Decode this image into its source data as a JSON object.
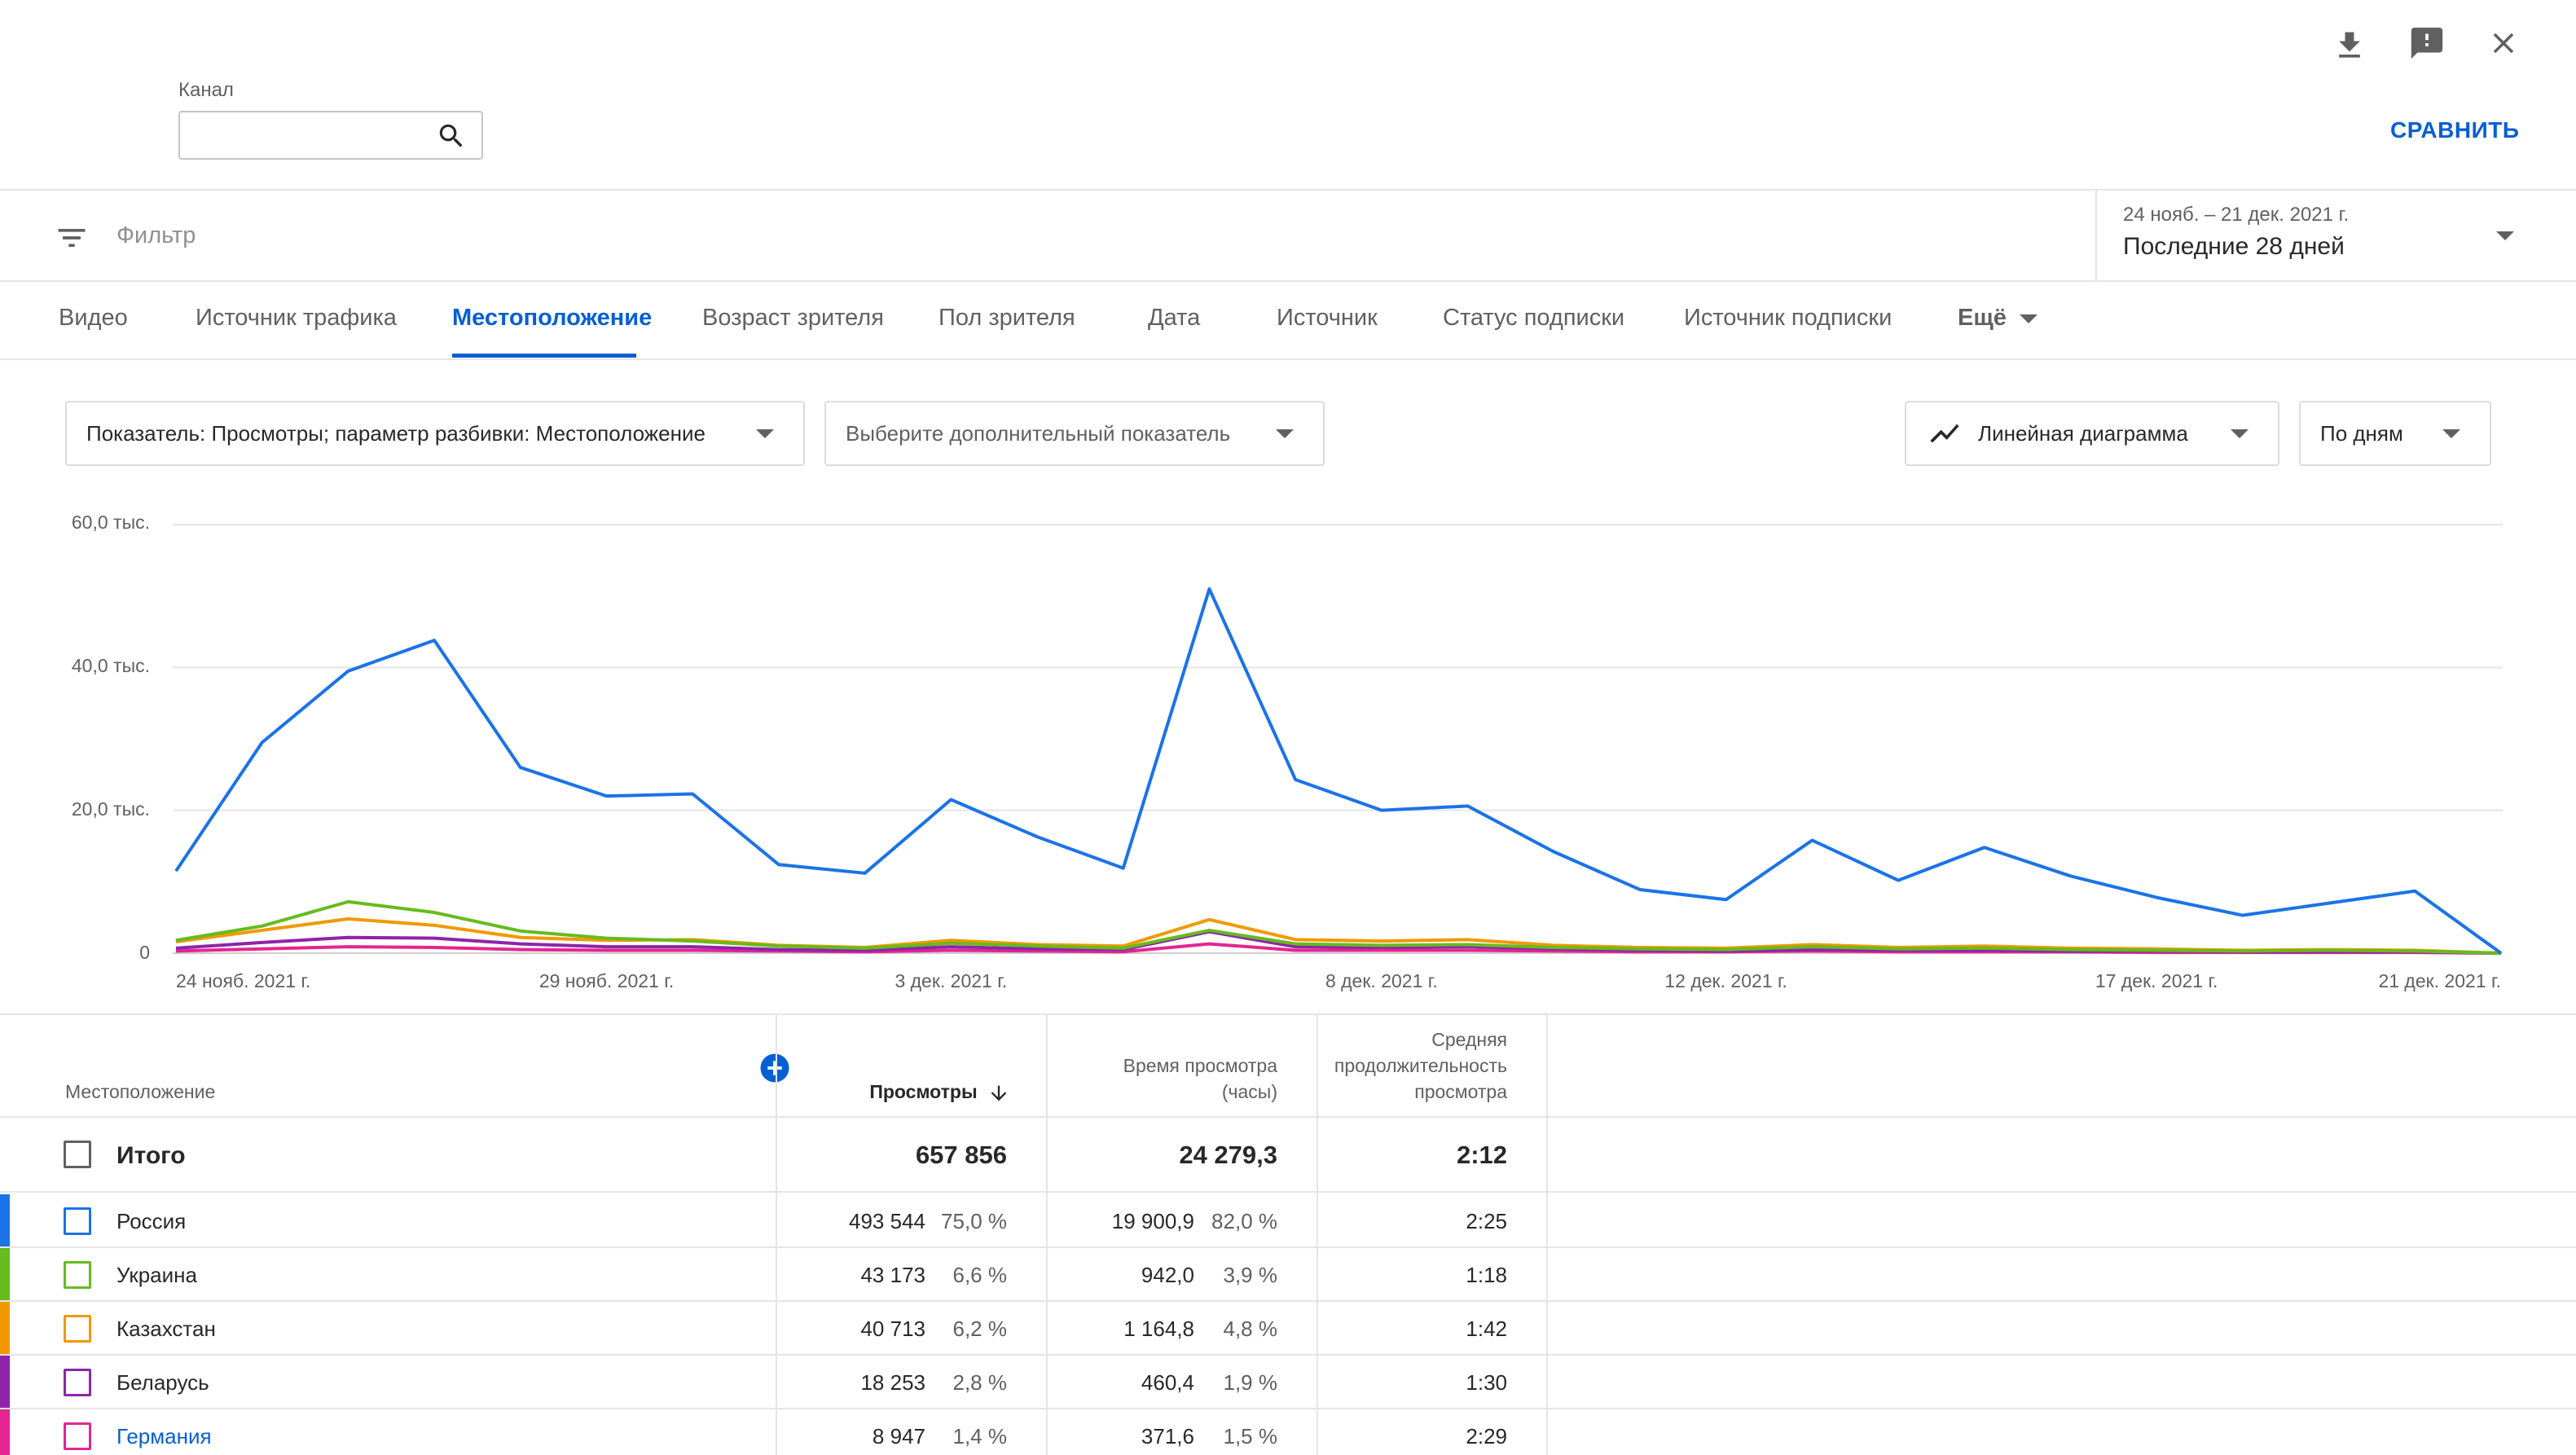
{
  "header": {
    "channel_label": "Канал",
    "search_placeholder": "",
    "compare_label": "СРАВНИТЬ"
  },
  "filter": {
    "label": "Фильтр",
    "date_range": "24 нояб. – 21 дек. 2021 г.",
    "period": "Последние 28 дней"
  },
  "tabs": [
    "Видео",
    "Источник трафика",
    "Местоположение",
    "Возраст зрителя",
    "Пол зрителя",
    "Дата",
    "Источник",
    "Статус подписки",
    "Источник подписки",
    "Ещё"
  ],
  "active_tab": "Местоположение",
  "controls": {
    "metric": "Показатель: Просмотры; параметр разбивки: Местоположение",
    "secondary_metric": "Выберите дополнительный показатель",
    "chart_type": "Линейная диаграмма",
    "granularity": "По дням"
  },
  "chart_data": {
    "type": "line",
    "y_ticks": [
      "60,0 тыс.",
      "40,0 тыс.",
      "20,0 тыс.",
      "0"
    ],
    "ylim": [
      0,
      60000
    ],
    "x_tick_labels": [
      {
        "label": "24 нояб. 2021 г.",
        "day": 0
      },
      {
        "label": "29 нояб. 2021 г.",
        "day": 5
      },
      {
        "label": "3 дек. 2021 г.",
        "day": 9
      },
      {
        "label": "8 дек. 2021 г.",
        "day": 14
      },
      {
        "label": "12 дек. 2021 г.",
        "day": 18
      },
      {
        "label": "17 дек. 2021 г.",
        "day": 23
      },
      {
        "label": "21 дек. 2021 г.",
        "day": 27
      }
    ],
    "days": 28,
    "grid": true,
    "series": [
      {
        "name": "Россия",
        "color": "#1a73e8",
        "values": [
          11500,
          29500,
          39500,
          43800,
          26000,
          22000,
          22300,
          12400,
          11200,
          21500,
          16300,
          11900,
          51000,
          24300,
          20000,
          20600,
          14200,
          8900,
          7500,
          15800,
          10200,
          14800,
          10800,
          7800,
          5300,
          7000,
          8700,
          0
        ]
      },
      {
        "name": "Украина",
        "color": "#66bb1e",
        "values": [
          1800,
          3800,
          7200,
          5700,
          3100,
          2100,
          1700,
          1000,
          700,
          1400,
          1000,
          700,
          3200,
          1300,
          1100,
          1200,
          800,
          600,
          500,
          900,
          600,
          700,
          500,
          400,
          300,
          400,
          300,
          0
        ]
      },
      {
        "name": "Казахстан",
        "color": "#f29900",
        "values": [
          1600,
          3200,
          4800,
          3900,
          2200,
          1800,
          1900,
          1100,
          800,
          1800,
          1200,
          1000,
          4700,
          1900,
          1700,
          1900,
          1100,
          800,
          700,
          1200,
          800,
          1000,
          700,
          600,
          400,
          500,
          400,
          0
        ]
      },
      {
        "name": "Беларусь",
        "color": "#8e24aa",
        "values": [
          700,
          1500,
          2200,
          2100,
          1300,
          900,
          900,
          500,
          400,
          900,
          600,
          500,
          3000,
          900,
          800,
          900,
          600,
          400,
          300,
          500,
          400,
          400,
          300,
          300,
          200,
          200,
          200,
          0
        ]
      },
      {
        "name": "Германия",
        "color": "#e52592",
        "values": [
          300,
          600,
          900,
          800,
          500,
          400,
          400,
          300,
          200,
          400,
          300,
          200,
          1300,
          400,
          400,
          400,
          300,
          200,
          200,
          300,
          200,
          200,
          200,
          100,
          100,
          100,
          100,
          0
        ]
      }
    ]
  },
  "table": {
    "col_location": "Местоположение",
    "col_views": "Просмотры",
    "col_watch_time_line1": "Время просмотра",
    "col_watch_time_line2": "(часы)",
    "col_avg_line1": "Средняя",
    "col_avg_line2": "продолжительность",
    "col_avg_line3": "просмотра",
    "total": {
      "label": "Итого",
      "views": "657 856",
      "watch_time": "24 279,3",
      "avg": "2:12"
    },
    "rows": [
      {
        "name": "Россия",
        "color": "#1a73e8",
        "views": "493 544",
        "views_pct": "75,0 %",
        "watch_time": "19 900,9",
        "watch_pct": "82,0 %",
        "avg": "2:25"
      },
      {
        "name": "Украина",
        "color": "#66bb1e",
        "views": "43 173",
        "views_pct": "6,6 %",
        "watch_time": "942,0",
        "watch_pct": "3,9 %",
        "avg": "1:18"
      },
      {
        "name": "Казахстан",
        "color": "#f29900",
        "views": "40 713",
        "views_pct": "6,2 %",
        "watch_time": "1 164,8",
        "watch_pct": "4,8 %",
        "avg": "1:42"
      },
      {
        "name": "Беларусь",
        "color": "#8e24aa",
        "views": "18 253",
        "views_pct": "2,8 %",
        "watch_time": "460,4",
        "watch_pct": "1,9 %",
        "avg": "1:30"
      },
      {
        "name": "Германия",
        "color": "#e52592",
        "views": "8 947",
        "views_pct": "1,4 %",
        "watch_time": "371,6",
        "watch_pct": "1,5 %",
        "avg": "2:29"
      }
    ]
  },
  "colors": {
    "accent": "#065fd4",
    "text": "#282828",
    "secondary": "#606060",
    "divider": "#e5e5e5"
  }
}
